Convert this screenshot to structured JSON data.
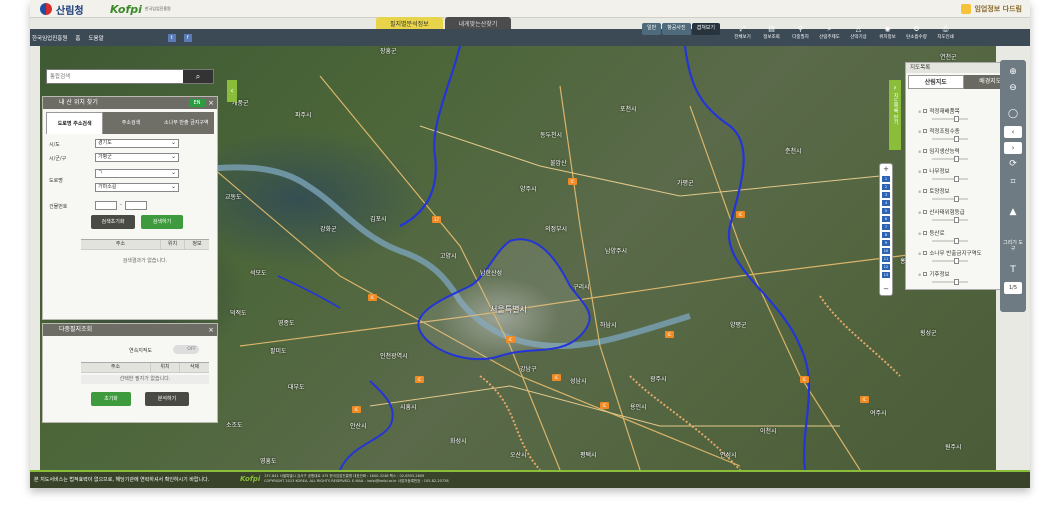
{
  "header": {
    "logo1": "산림청",
    "logo2": "Kofpi",
    "logo2_sub": "한국임업진흥원",
    "logo3": "임업정보 다드림"
  },
  "top_tabs": [
    {
      "label": "필지별분석정보",
      "active": true
    },
    {
      "label": "내게맞는산찾기",
      "active": false
    }
  ],
  "nav": {
    "org": "한국임업진흥원",
    "home": "홈",
    "help": "도움말",
    "twitter_icon": "twitter-icon",
    "facebook_icon": "facebook-icon"
  },
  "map_types": [
    {
      "label": "일반",
      "active": false
    },
    {
      "label": "항공사진",
      "active": false
    },
    {
      "label": "겹쳐보기",
      "active": true
    }
  ],
  "tools": [
    {
      "label": "전체보기",
      "icon": "expand-icon",
      "glyph": "⤢"
    },
    {
      "label": "정보조회",
      "icon": "info-icon",
      "glyph": "▤"
    },
    {
      "label": "다중필지",
      "icon": "pin-icon",
      "glyph": "⚲"
    },
    {
      "label": "산림주제도",
      "icon": "search-icon",
      "glyph": "⌕"
    },
    {
      "label": "산악기상",
      "icon": "mountain-icon",
      "glyph": "△"
    },
    {
      "label": "위치정보",
      "icon": "location-icon",
      "glyph": "◉"
    },
    {
      "label": "탄소흡수량",
      "icon": "gear-icon",
      "glyph": "⚙"
    },
    {
      "label": "지도인쇄",
      "icon": "print-icon",
      "glyph": "⎙"
    }
  ],
  "search": {
    "placeholder": "통합검색",
    "value": "통합검색  ·"
  },
  "my_mountain": {
    "title": "내 산 위치 찾기",
    "en_label": "EN",
    "tabs": [
      "도로명 주소검색",
      "주소검색",
      "소나무 반출 금지구역"
    ],
    "sido_label": "시/도",
    "sido_value": "경기도",
    "sigungu_label": "시/군/구",
    "sigungu_value": "가평군",
    "road_label": "도로명",
    "road_value1": "ㄱ",
    "road_value2": "가마소길",
    "building_label": "건물번호",
    "building_sep": "-",
    "reset_btn": "검색초기화",
    "search_btn": "검색하기",
    "table_headers": [
      "주소",
      "위치",
      "정보"
    ],
    "no_result": "검색결과가 없습니다."
  },
  "multi_parcel": {
    "title": "다중필지조회",
    "continuous_label": "연속지적도",
    "toggle": "OFF",
    "table_headers": [
      "주소",
      "위치",
      "삭제"
    ],
    "no_result": "선택한 필지가 없습니다.",
    "reset_btn": "초기화",
    "analyze_btn": "분석하기"
  },
  "layer_panel": {
    "title": "지도목록",
    "tabs": [
      "산림지도",
      "배경지도"
    ],
    "layers": [
      "적정재배품목",
      "적정조림수종",
      "임지생산능력",
      "나무정보",
      "토양정보",
      "산사태위험등급",
      "등산로",
      "소나무 반출금지구역도",
      "기후정보"
    ]
  },
  "side_labels": {
    "layer_list_vertical": "지도목록 닫기"
  },
  "zoom_ticks": [
    "1",
    "2",
    "3",
    "4",
    "5",
    "6",
    "7",
    "8",
    "9",
    "10",
    "11",
    "12",
    "13"
  ],
  "right_tools": {
    "draw_label": "그리기 도구",
    "text_tool": "T",
    "scale": "1/5"
  },
  "map_labels": [
    {
      "text": "장흥군"
    },
    {
      "text": "연천군"
    },
    {
      "text": "포천시"
    },
    {
      "text": "동두천시"
    },
    {
      "text": "양주시"
    },
    {
      "text": "가평군"
    },
    {
      "text": "남양주시"
    },
    {
      "text": "의정부시"
    },
    {
      "text": "구리시"
    },
    {
      "text": "서울특별시"
    },
    {
      "text": "하남시"
    },
    {
      "text": "양평군"
    },
    {
      "text": "광주시"
    },
    {
      "text": "성남시"
    },
    {
      "text": "김포시"
    },
    {
      "text": "강화군"
    },
    {
      "text": "교동도"
    },
    {
      "text": "석모도"
    },
    {
      "text": "인천광역시"
    },
    {
      "text": "시흥시"
    },
    {
      "text": "안산시"
    },
    {
      "text": "횡성군"
    },
    {
      "text": "홍천군"
    },
    {
      "text": "여주시"
    },
    {
      "text": "이천시"
    },
    {
      "text": "용인시"
    },
    {
      "text": "남한산성"
    },
    {
      "text": "고양시"
    },
    {
      "text": "파주시"
    },
    {
      "text": "춘천시"
    },
    {
      "text": "개풍군"
    },
    {
      "text": "영종도"
    },
    {
      "text": "덕적도"
    },
    {
      "text": "대부도"
    },
    {
      "text": "소조도"
    },
    {
      "text": "영흥도"
    },
    {
      "text": "불암산"
    },
    {
      "text": "강남구"
    },
    {
      "text": "팔미도"
    },
    {
      "text": "화성시"
    },
    {
      "text": "오산시"
    },
    {
      "text": "평택시"
    },
    {
      "text": "안성시"
    },
    {
      "text": "원주시"
    }
  ],
  "footer": {
    "note": "본 지도서비스는 법적효력이 없으므로, 해당기관에 연락하셔서 확인하시기 바랍니다.",
    "logo": "Kofpi",
    "address": "137-841 서울특별시 강서구 공항대로 475 한국임업진흥원 대표전화 : 1600-3248 팩스 : 02-6393-2609",
    "copyright": "COPYRIGHT 2013 KOREA. ALL RIGHTS RESERVED. E-MAIL : kofpi@kofpi.or.kr 사업자등록번호 : 105-82-20738"
  },
  "colors": {
    "accent_green": "#8abd3a",
    "tab_yellow": "#e8d44a",
    "nav_dark": "#3c4a56",
    "boundary_blue": "#2435d8"
  }
}
